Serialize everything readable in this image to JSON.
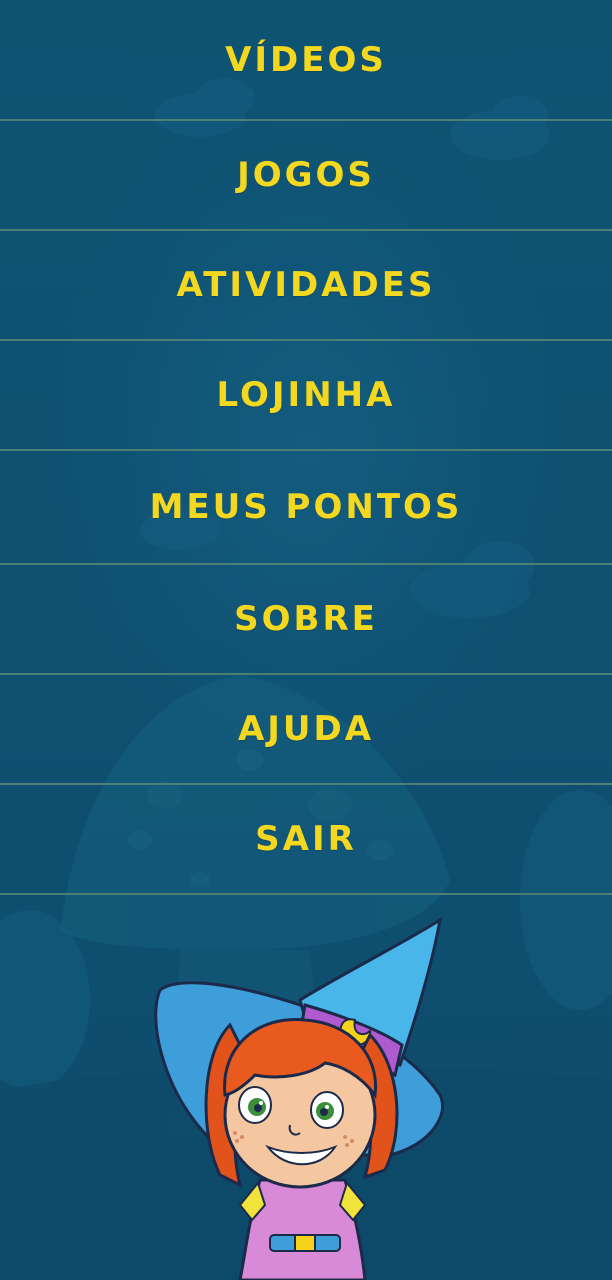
{
  "menu": {
    "items": [
      {
        "label": "VÍDEOS"
      },
      {
        "label": "JOGOS"
      },
      {
        "label": "ATIVIDADES"
      },
      {
        "label": "LOJINHA"
      },
      {
        "label": "MEUS PONTOS"
      },
      {
        "label": "SOBRE"
      },
      {
        "label": "AJUDA"
      },
      {
        "label": "SAIR"
      }
    ]
  },
  "colors": {
    "background": "#0f4e6e",
    "label": "#f4d81f",
    "divider": "#4d8074"
  },
  "illustrations": {
    "background": "mushroom-scenery",
    "mascot": "witch-girl-mascot"
  }
}
